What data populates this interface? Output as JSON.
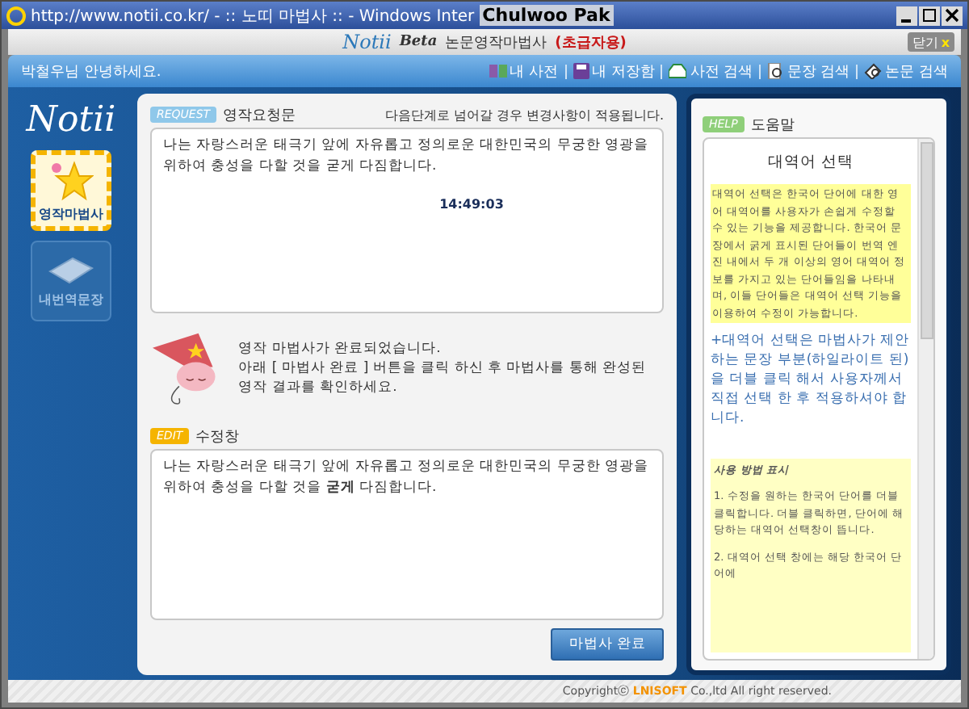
{
  "window": {
    "title": "http://www.notii.co.kr/ - :: 노띠 마법사 :: - Windows Inter",
    "overlay_label": "Chulwoo Pak"
  },
  "header": {
    "logo": "Notii",
    "logo_badge": "Beta",
    "app_name": "논문영작마법사",
    "level": "(초급자용)",
    "close_button": {
      "label": "닫기",
      "mark": "x"
    }
  },
  "nav": {
    "greeting": "박철우님 안녕하세요.",
    "items": [
      {
        "label": "내 사전",
        "kind": "book"
      },
      {
        "label": "내 저장함",
        "kind": "disk"
      },
      {
        "label": "사전 검색",
        "kind": "tray"
      },
      {
        "label": "문장 검색",
        "kind": "page"
      },
      {
        "label": "논문 검색",
        "kind": "papers"
      }
    ]
  },
  "sidebar": {
    "logo": "Notii",
    "items": [
      {
        "label": "영작마법사",
        "kind": "star",
        "selected": true
      },
      {
        "label": "내번역문장",
        "kind": "notebook",
        "selected": false
      }
    ]
  },
  "request": {
    "badge": "REQUEST",
    "title": "영작요청문",
    "notice": "다음단계로 넘어갈 경우 변경사항이 적용됩니다.",
    "text": "나는 자랑스러운 태극기 앞에 자유롭고 정의로운 대한민국의 무궁한 영광을 위하여 충성을 다할 것을 굳게 다짐합니다.",
    "time": "14:49:03"
  },
  "wizard_message": "영작 마법사가 완료되었습니다.\n아래 [ 마법사 완료 ] 버튼을 클릭 하신 후 마법사를 통해 완성된 영작 결과를 확인하세요.",
  "edit": {
    "badge": "EDIT",
    "title": "수정창",
    "text": "나는 자랑스러운 태극기 앞에 자유롭고 정의로운 대한민국의 무궁한 영광을 위하여 충성을 다할 것을 **굳게** 다짐합니다."
  },
  "finish_button": "마법사 완료",
  "help": {
    "badge": "HELP",
    "title": "도움말",
    "heading": "대역어 선택",
    "blocks": [
      {
        "kind": "note",
        "text": "대역어 선택은 한국어 단어에 대한 영어 대역어를 사용자가 손쉽게 수정할 수 있는 기능을 제공합니다. 한국어 문장에서 굵게 표시된 단어들이 번역 엔진 내에서 두 개 이상의 영어 대역어 정보를 가지고 있는 단어들임을 나타내며, 이들 단어들은 대역어 선택 기능을 이용하여 수정이 가능합니다."
      },
      {
        "kind": "tip",
        "text": "+대역어 선택은 마법사가 제안하는 문장 부분(하일라이트 된)을 더블 클릭 해서 사용자께서 직접 선택 한 후 적용하셔야 합니다."
      },
      {
        "kind": "steps",
        "title": "사용 방법 표시",
        "steps": [
          "1. 수정을 원하는 한국어 단어를 더블 클릭합니다. 더블 클릭하면, 단어에 해당하는 대역어 선택창이 뜹니다.",
          "2. 대역어 선택 창에는 해당 한국어 단어에"
        ]
      }
    ]
  },
  "footer": {
    "prefix": "Copyright",
    "symbol": "ⓒ",
    "brand": "LNISOFT",
    "suffix": "Co.,ltd All right reserved."
  }
}
